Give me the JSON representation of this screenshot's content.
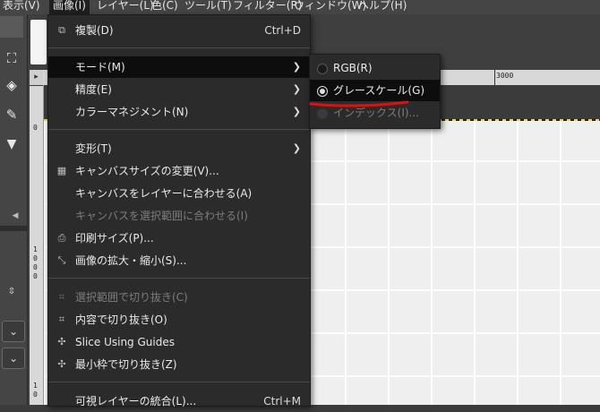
{
  "menubar": {
    "items": [
      {
        "label": "表示(V)"
      },
      {
        "label": "画像(I)"
      },
      {
        "label": "レイヤー(L)"
      },
      {
        "label": "色(C)"
      },
      {
        "label": "ツール(T)"
      },
      {
        "label": "フィルター(R)"
      },
      {
        "label": "ウィンドウ(W)"
      },
      {
        "label": "ヘルプ(H)"
      }
    ]
  },
  "image_menu": {
    "items": [
      {
        "label": "複製(D)",
        "shortcut": "Ctrl+D",
        "icon": "duplicate-icon"
      },
      {
        "label": "モード(M)",
        "submenu": true
      },
      {
        "label": "精度(E)",
        "submenu": true
      },
      {
        "label": "カラーマネジメント(N)",
        "submenu": true
      },
      {
        "label": "変形(T)",
        "submenu": true
      },
      {
        "label": "キャンバスサイズの変更(V)...",
        "icon": "canvas-size-icon"
      },
      {
        "label": "キャンバスをレイヤーに合わせる(A)"
      },
      {
        "label": "キャンバスを選択範囲に合わせる(I)",
        "disabled": true
      },
      {
        "label": "印刷サイズ(P)...",
        "icon": "print-icon"
      },
      {
        "label": "画像の拡大・縮小(S)...",
        "icon": "scale-icon"
      },
      {
        "label": "選択範囲で切り抜き(C)",
        "disabled": true,
        "icon": "crop-icon"
      },
      {
        "label": "内容で切り抜き(O)",
        "icon": "crop-icon"
      },
      {
        "label": "Slice Using Guides",
        "icon": "slice-icon"
      },
      {
        "label": "最小枠で切り抜き(Z)",
        "icon": "zealous-crop-icon"
      },
      {
        "label": "可視レイヤーの統合(L)...",
        "shortcut": "Ctrl+M"
      }
    ]
  },
  "mode_submenu": {
    "items": [
      {
        "label": "RGB(R)",
        "checked": false
      },
      {
        "label": "グレースケール(G)",
        "checked": true
      },
      {
        "label": "インデックス(I)...",
        "checked": false,
        "disabled": true
      }
    ]
  },
  "ruler": {
    "h_label": "3000",
    "v_top": "0",
    "v_labels": [
      "1",
      "0",
      "0",
      "0"
    ]
  },
  "colors": {
    "menu_bg": "#2b2b2b",
    "highlight": "#0d0d0d",
    "annotation": "#e01010"
  }
}
